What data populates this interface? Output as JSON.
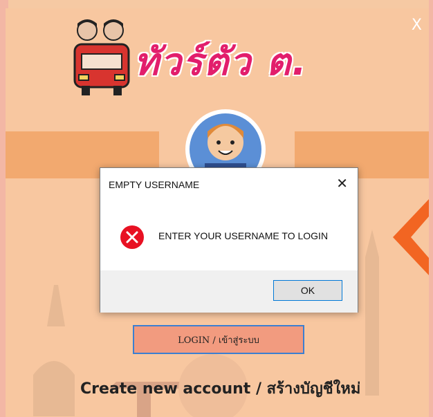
{
  "window": {
    "close_label": "X",
    "logo_text": "ทัวร์ตัว ต."
  },
  "login": {
    "button_label": "LOGIN / เข้าสู่ระบบ",
    "create_account_label": "Create new account / สร้างบัญชีใหม่"
  },
  "dialog": {
    "title": "EMPTY USERNAME",
    "close_label": "✕",
    "message": "ENTER YOUR USERNAME TO LOGIN",
    "ok_label": "OK",
    "icon": "error-icon"
  },
  "colors": {
    "background": "#f8c7a0",
    "band": "#f2a96f",
    "logo": "#e21e6c",
    "login_button": "#f29b7f",
    "accent_border": "#3b7fd1",
    "error_red": "#e81123"
  }
}
